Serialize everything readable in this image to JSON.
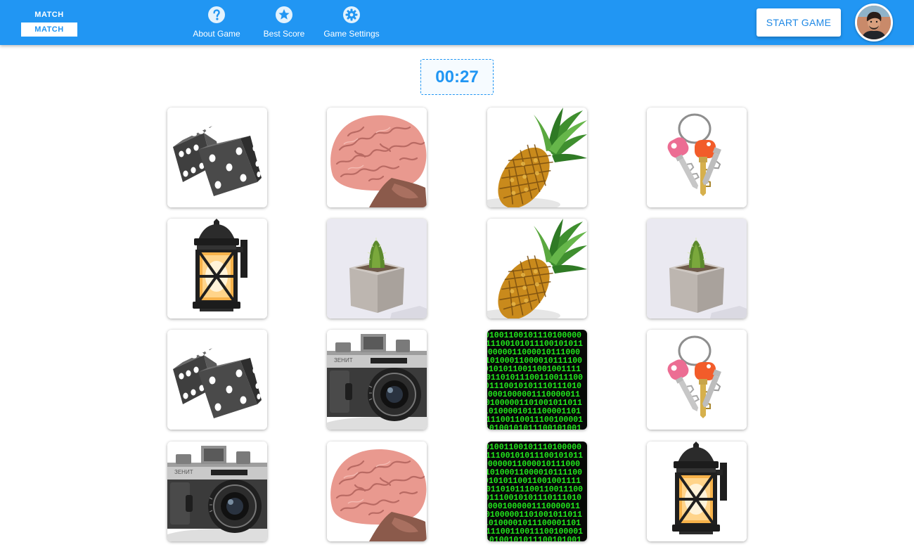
{
  "header": {
    "logo_top": "MATCH",
    "logo_bottom": "MATCH",
    "nav": [
      {
        "label": "About Game",
        "icon": "question-circle-icon"
      },
      {
        "label": "Best Score",
        "icon": "star-circle-icon"
      },
      {
        "label": "Game Settings",
        "icon": "gear-icon"
      }
    ],
    "start_button": "START GAME",
    "avatar": "user-avatar"
  },
  "timer": "00:27",
  "colors": {
    "primary": "#2196f3",
    "white": "#ffffff"
  },
  "board": {
    "rows": 4,
    "cols": 4,
    "cards": [
      "dice",
      "brain",
      "pineapple",
      "keys",
      "lantern",
      "cactus",
      "pineapple",
      "cactus",
      "dice",
      "camera",
      "binary-code",
      "keys",
      "camera",
      "brain",
      "binary-code",
      "lantern"
    ]
  }
}
